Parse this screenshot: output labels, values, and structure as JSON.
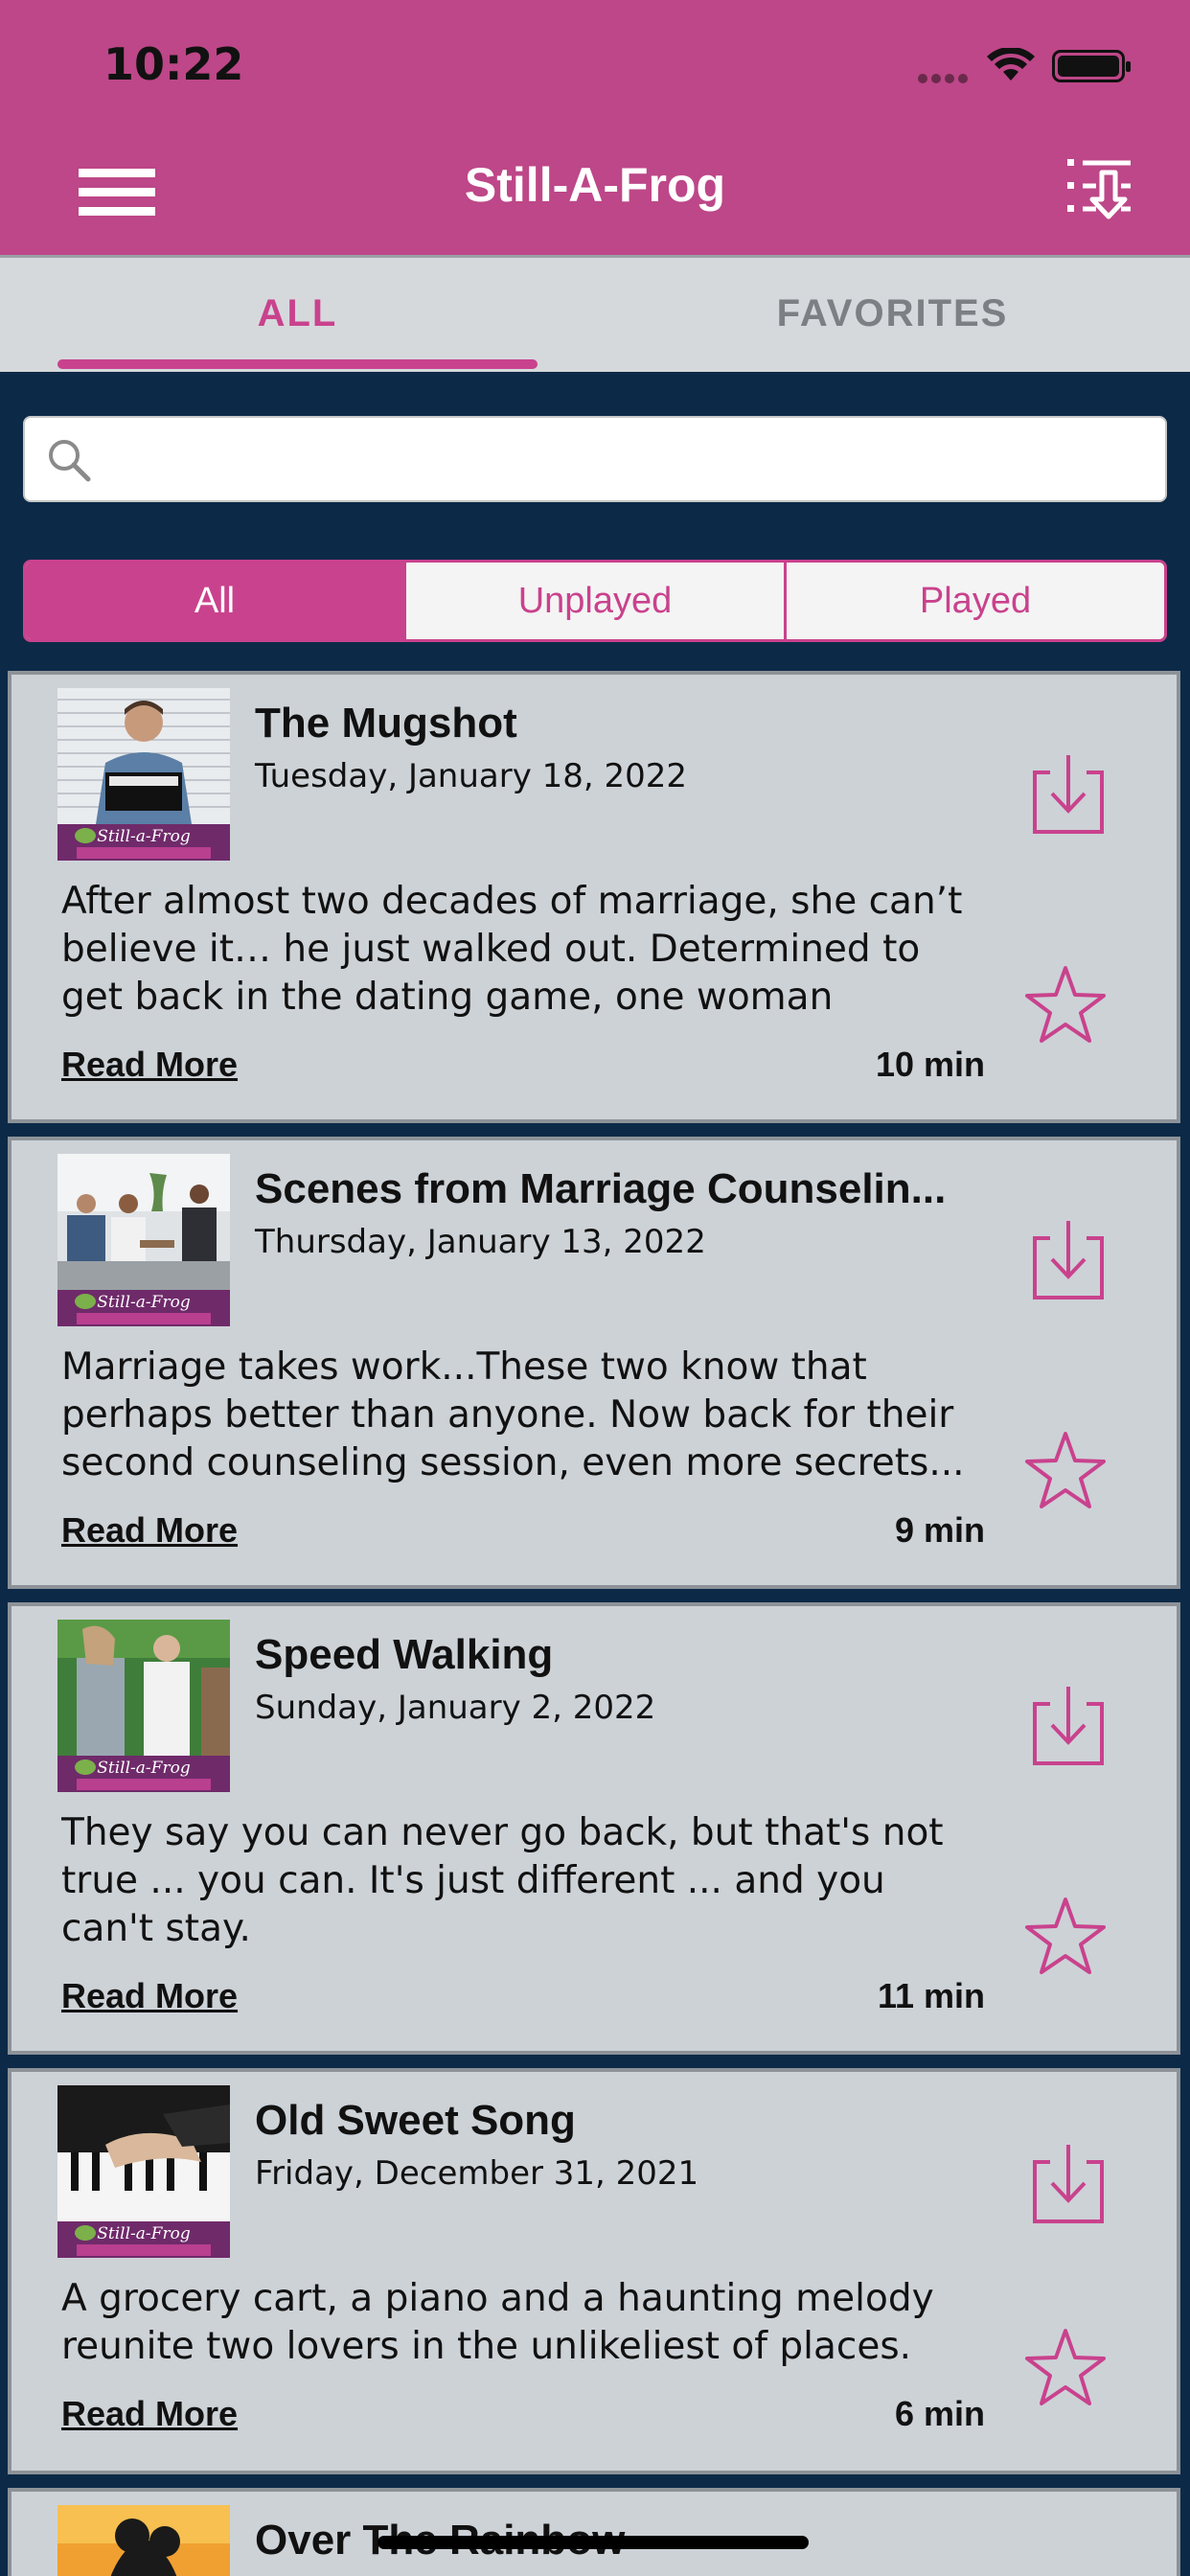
{
  "status_bar": {
    "time": "10:22"
  },
  "header": {
    "title": "Still-A-Frog",
    "menu_icon": "hamburger-menu-icon",
    "downloads_icon": "downloads-list-icon"
  },
  "tabs": [
    {
      "label": "ALL",
      "selected": true
    },
    {
      "label": "FAVORITES",
      "selected": false
    }
  ],
  "search": {
    "placeholder": "",
    "value": ""
  },
  "filter": {
    "options": [
      "All",
      "Unplayed",
      "Played"
    ],
    "selected": "All"
  },
  "thumbnail_brand": "Still-a-Frog",
  "episodes": [
    {
      "title": "The Mugshot",
      "date": "Tuesday, January 18, 2022",
      "description": "After almost two decades of marriage, she can’t believe it… he just walked out. Determined to get back in the dating game, one woman believes s...",
      "read_more": "Read More",
      "duration": "10 min"
    },
    {
      "title": "Scenes from Marriage Counselin...",
      "date": "Thursday, January 13, 2022",
      "description": "Marriage takes work...These two know that perhaps better than anyone. Now back for their second counseling session,  even more secrets...",
      "read_more": "Read More",
      "duration": "9 min"
    },
    {
      "title": "Speed Walking",
      "date": "Sunday, January 2, 2022",
      "description": "They say you can never go back, but that's not true ... you can. It's just different ... and you can't stay.",
      "read_more": "Read More",
      "duration": "11 min"
    },
    {
      "title": "Old Sweet Song",
      "date": "Friday, December 31, 2021",
      "description": "A grocery cart, a piano and a haunting melody reunite two lovers in the unlikeliest of places.",
      "read_more": "Read More",
      "duration": "6 min"
    },
    {
      "title": "Over The Rainbow"
    }
  ],
  "colors": {
    "brand_pink": "#bd4788",
    "accent_pink": "#c9428d",
    "background_navy": "#0c2a48",
    "card_gray": "#cdd2d7"
  }
}
